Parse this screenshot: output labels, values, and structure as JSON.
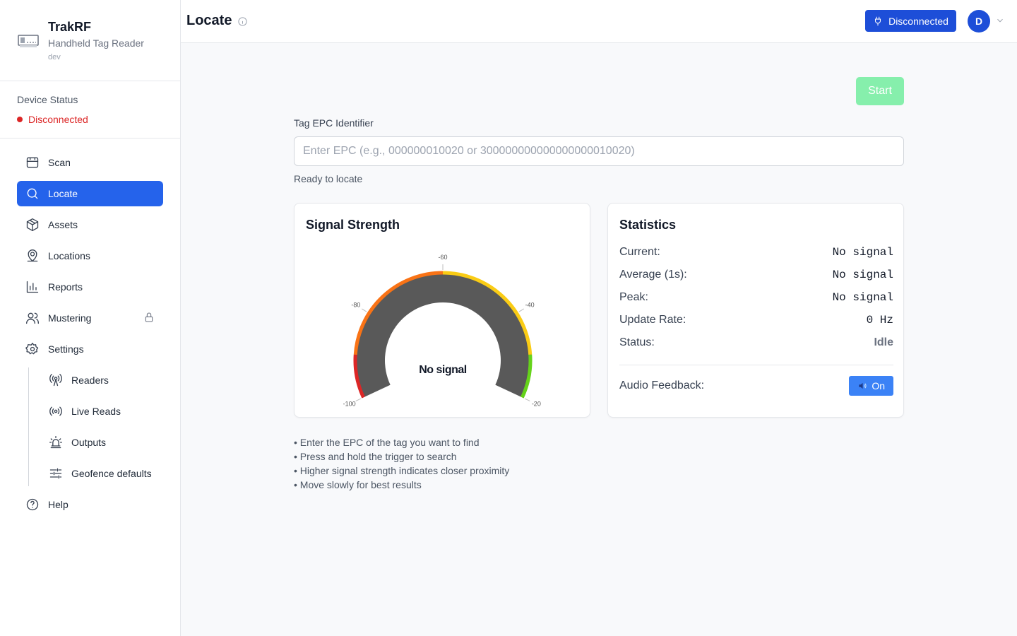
{
  "brand": {
    "name": "TrakRF",
    "subtitle": "Handheld Tag Reader",
    "env": "dev",
    "logo_icon": "reader-device-icon"
  },
  "device_status": {
    "title": "Device Status",
    "value": "Disconnected",
    "color": "#dc2626"
  },
  "sidebar": {
    "items": [
      {
        "label": "Scan",
        "icon": "inbox-icon"
      },
      {
        "label": "Locate",
        "icon": "search-icon",
        "active": true
      },
      {
        "label": "Assets",
        "icon": "box-icon"
      },
      {
        "label": "Locations",
        "icon": "map-pin-icon"
      },
      {
        "label": "Reports",
        "icon": "bar-chart-icon"
      },
      {
        "label": "Mustering",
        "icon": "users-icon",
        "locked": true
      },
      {
        "label": "Settings",
        "icon": "gear-icon"
      }
    ],
    "settings_sub": [
      {
        "label": "Readers",
        "icon": "radio-tower-icon"
      },
      {
        "label": "Live Reads",
        "icon": "broadcast-icon"
      },
      {
        "label": "Outputs",
        "icon": "siren-icon"
      },
      {
        "label": "Geofence defaults",
        "icon": "sliders-icon"
      }
    ],
    "help": {
      "label": "Help",
      "icon": "help-circle-icon"
    }
  },
  "header": {
    "title": "Locate",
    "connection_label": "Disconnected",
    "avatar_initial": "D",
    "accent": "#1d4ed8"
  },
  "locate": {
    "start_label": "Start",
    "field_label": "Tag EPC Identifier",
    "placeholder": "Enter EPC (e.g., 000000010020 or 300000000000000000010020)",
    "value": "",
    "status": "Ready to locate"
  },
  "signal": {
    "title": "Signal Strength",
    "center_text": "No signal",
    "ticks": [
      "-100",
      "-80",
      "-60",
      "-40",
      "-20"
    ],
    "range": [
      -100,
      -20
    ],
    "bands": [
      {
        "from": -100,
        "to": -90,
        "color": "#dc2626"
      },
      {
        "from": -90,
        "to": -60,
        "color": "#f97316"
      },
      {
        "from": -60,
        "to": -30,
        "color": "#facc15"
      },
      {
        "from": -30,
        "to": -20,
        "color": "#65d31a"
      }
    ],
    "value": null
  },
  "stats": {
    "title": "Statistics",
    "rows": [
      {
        "label": "Current:",
        "value": "No signal"
      },
      {
        "label": "Average (1s):",
        "value": "No signal"
      },
      {
        "label": "Peak:",
        "value": "No signal"
      },
      {
        "label": "Update Rate:",
        "value": "0 Hz"
      },
      {
        "label": "Status:",
        "value": "Idle"
      }
    ],
    "audio_label": "Audio Feedback:",
    "audio_value": "On"
  },
  "tips": [
    "• Enter the EPC of the tag you want to find",
    "• Press and hold the trigger to search",
    "• Higher signal strength indicates closer proximity",
    "• Move slowly for best results"
  ]
}
